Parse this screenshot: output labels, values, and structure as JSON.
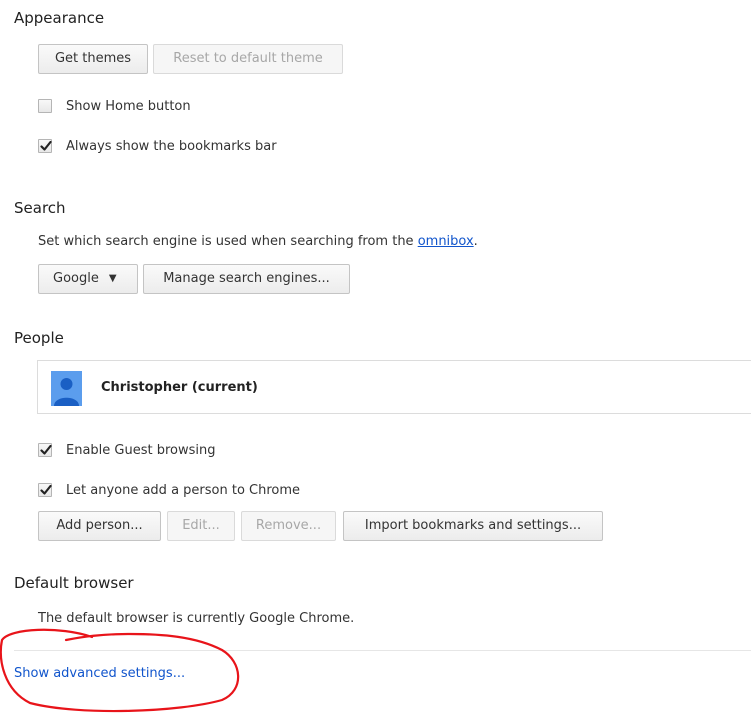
{
  "appearance": {
    "title": "Appearance",
    "get_themes": "Get themes",
    "reset_theme": "Reset to default theme",
    "show_home": {
      "label": "Show Home button",
      "checked": false
    },
    "bookmarks_bar": {
      "label": "Always show the bookmarks bar",
      "checked": true
    }
  },
  "search": {
    "title": "Search",
    "description": "Set which search engine is used when searching from the ",
    "omnibox_link": "omnibox",
    "description_end": ".",
    "engine": "Google",
    "manage": "Manage search engines..."
  },
  "people": {
    "title": "People",
    "profile_name": "Christopher (current)",
    "guest": {
      "label": "Enable Guest browsing",
      "checked": true
    },
    "anyone_add": {
      "label": "Let anyone add a person to Chrome",
      "checked": true
    },
    "add_person": "Add person...",
    "edit": "Edit...",
    "remove": "Remove...",
    "import": "Import bookmarks and settings..."
  },
  "default_browser": {
    "title": "Default browser",
    "status": "The default browser is currently Google Chrome."
  },
  "advanced_link": "Show advanced settings...",
  "colors": {
    "link": "#1155cc",
    "avatar": "#5b9ded",
    "annotation": "#e8141a"
  }
}
